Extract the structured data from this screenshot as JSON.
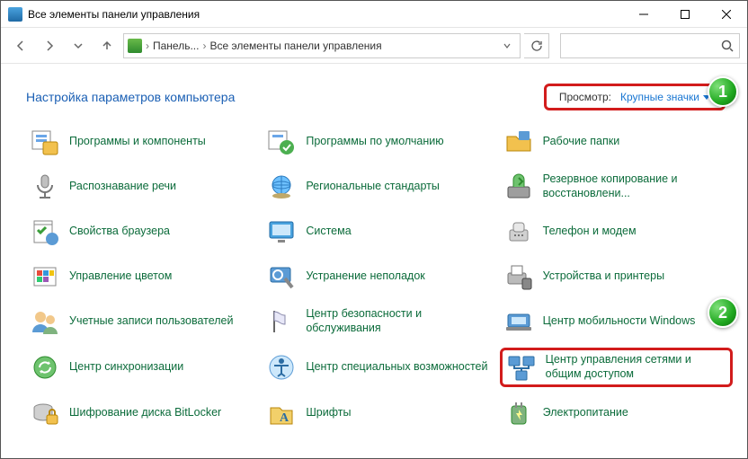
{
  "window": {
    "title": "Все элементы панели управления"
  },
  "nav": {
    "crumb1": "Панель...",
    "crumb2": "Все элементы панели управления"
  },
  "header": {
    "title": "Настройка параметров компьютера",
    "view_label": "Просмотр:",
    "view_value": "Крупные значки"
  },
  "callouts": {
    "one": "1",
    "two": "2"
  },
  "items": {
    "r0c0": "Программы и компоненты",
    "r0c1": "Программы по умолчанию",
    "r0c2": "Рабочие папки",
    "r1c0": "Распознавание речи",
    "r1c1": "Региональные стандарты",
    "r1c2": "Резервное копирование и восстановлени...",
    "r2c0": "Свойства браузера",
    "r2c1": "Система",
    "r2c2": "Телефон и модем",
    "r3c0": "Управление цветом",
    "r3c1": "Устранение неполадок",
    "r3c2": "Устройства и принтеры",
    "r4c0": "Учетные записи пользователей",
    "r4c1": "Центр безопасности и обслуживания",
    "r4c2": "Центр мобильности Windows",
    "r5c0": "Центр синхронизации",
    "r5c1": "Центр специальных возможностей",
    "r5c2": "Центр управления сетями и общим доступом",
    "r6c0": "Шифрование диска BitLocker",
    "r6c1": "Шрифты",
    "r6c2": "Электропитание"
  }
}
